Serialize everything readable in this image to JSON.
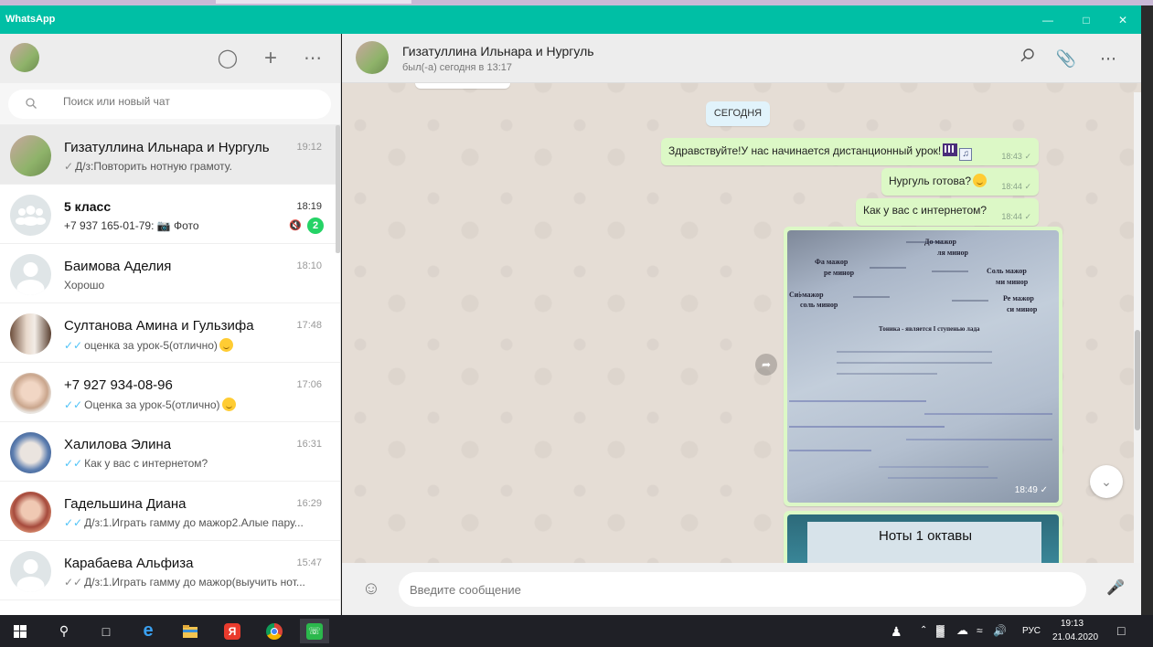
{
  "window": {
    "title": "WhatsApp"
  },
  "sidebar": {
    "search_placeholder": "Поиск или новый чат",
    "chats": [
      {
        "name": "Гизатуллина Ильнара и Нургуль",
        "time": "19:12",
        "tick": "✓",
        "preview": "Д/з:Повторить нотную грамоту."
      },
      {
        "name": "5 класс",
        "time": "18:19",
        "preview": "+7 937 165-01-79: 📷 Фото",
        "unread": "2"
      },
      {
        "name": "Баимова Аделия",
        "time": "18:10",
        "preview": "Хорошо"
      },
      {
        "name": "Султанова Амина и Гульзифа",
        "time": "17:48",
        "tick": "✓✓",
        "preview": "оценка за урок-5(отлично)"
      },
      {
        "name": "+7 927 934-08-96",
        "time": "17:06",
        "tick": "✓✓",
        "preview": "Оценка за урок-5(отлично)"
      },
      {
        "name": "Халилова Элина",
        "time": "16:31",
        "tick": "✓✓",
        "preview": "Как у вас с интернетом?"
      },
      {
        "name": "Гадельшина Диана",
        "time": "16:29",
        "tick": "✓✓",
        "preview": "Д/з:1.Играть гамму до мажор2.Алые пару..."
      },
      {
        "name": "Карабаева Альфиза",
        "time": "15:47",
        "tick": "✓✓",
        "preview": "Д/з:1.Играть гамму до мажор(выучить нот..."
      }
    ]
  },
  "chat": {
    "title": "Гизатуллина Ильнара и Нургуль",
    "status": "был(-а) сегодня в 13:17",
    "date_chip": "СЕГОДНЯ",
    "messages": [
      {
        "text": "Здравствуйте!У нас начинается дистанционный урок!",
        "time": "18:43"
      },
      {
        "text": "Нургуль готова?",
        "time": "18:44"
      },
      {
        "text": "Как у вас с интернетом?",
        "time": "18:44"
      }
    ],
    "image_message": {
      "time": "18:49",
      "sheet": {
        "do_major": "До мажор",
        "la_minor": "ля минор",
        "fa_major": "Фа мажор",
        "re_minor": "ре минор",
        "sol_major": "Соль мажор",
        "mi_minor": "ми минор",
        "si_flat_major": "Си♭мажор",
        "sol_minor": "соль минор",
        "re_major": "Ре мажор",
        "si_minor": "си минор",
        "tonika": "Тоника - является I ступенью лада"
      }
    },
    "image2_text": "Ноты 1 октавы",
    "input_placeholder": "Введите сообщение"
  },
  "taskbar": {
    "lang": "РУС",
    "time": "19:13",
    "date": "21.04.2020"
  }
}
